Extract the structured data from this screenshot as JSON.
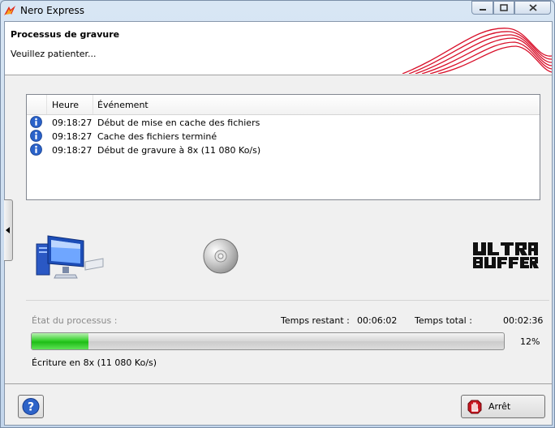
{
  "window": {
    "title": "Nero Express"
  },
  "header": {
    "title": "Processus de gravure",
    "subtitle": "Veuillez patienter..."
  },
  "log": {
    "columns": [
      "Heure",
      "Événement"
    ],
    "rows": [
      {
        "icon": "info-icon",
        "time": "09:18:27",
        "event": "Début de mise en cache des fichiers"
      },
      {
        "icon": "info-icon",
        "time": "09:18:27",
        "event": "Cache des fichiers terminé"
      },
      {
        "icon": "info-icon",
        "time": "09:18:27",
        "event": "Début de gravure à 8x (11 080 Ko/s)"
      }
    ]
  },
  "status": {
    "state_label": "État du processus :",
    "remaining_label": "Temps restant :",
    "remaining_value": "00:06:02",
    "total_label": "Temps total :",
    "total_value": "00:02:36",
    "progress_percent": 12,
    "progress_text": "12%",
    "writing_text": "Écriture en 8x (11 080 Ko/s)"
  },
  "buttons": {
    "stop_label": "Arrêt"
  },
  "colors": {
    "progress_green": "#1fbd17",
    "info_blue": "#2a62c9",
    "logo_red": "#d8102a"
  }
}
